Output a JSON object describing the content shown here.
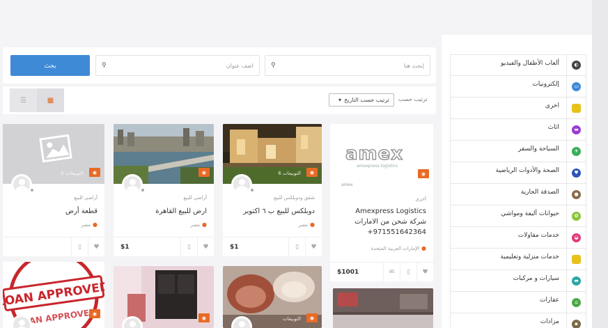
{
  "search": {
    "button_label": "بحث",
    "location_placeholder": "اضف عنوان",
    "query_placeholder": "إبحث هنا"
  },
  "sort": {
    "label": "ترتيب حسب",
    "selected": "ترتيب حسب التاريخ"
  },
  "listings": [
    {
      "category": "آخرى",
      "title_line1": "Amexpress Logistics",
      "title_line2": "شركة شحن من الامارات",
      "title_line3": "+971551642364",
      "location": "الإمارات العربية المتحدة",
      "price": "$1001",
      "badge": "",
      "logo_text": "amex",
      "logo_sub": "amexpress logistics",
      "logo_tiny": "amex"
    },
    {
      "category": "شقق ودوبلكس للبيع",
      "title": "دوبلكس للبيع ب ٦ اكتوبر",
      "location": "مصر",
      "price": "$1",
      "badge": "",
      "photos": "6 التوبيعات"
    },
    {
      "category": "أراضي للبيع",
      "title": "ارض للبيع القاهرة",
      "location": "مصر",
      "price": "$1",
      "badge": ""
    },
    {
      "category": "أراضي للبيع",
      "title": "قطعة أرض",
      "location": "مصر",
      "price": "",
      "badge": "",
      "photos": "0 التوبيعات"
    }
  ],
  "second_row": {
    "stamp_text_1": "LOAN APPROVED",
    "stamp_text_2": "LOAN APPROVED",
    "furniture_photos": "التوبيعات"
  },
  "sidebar": {
    "items": [
      {
        "label": "ألعاب الأطفال والفيديو",
        "icon": "game-icon",
        "color": "#444444"
      },
      {
        "label": "إلكترونيات",
        "icon": "monitor-icon",
        "color": "#3f8ad6"
      },
      {
        "label": "اخرى",
        "icon": "folder-icon",
        "color": "#e8c21a"
      },
      {
        "label": "اثاث",
        "icon": "sofa-icon",
        "color": "#9b3ad6"
      },
      {
        "label": "السياحة والسفر",
        "icon": "plane-icon",
        "color": "#3aae5a"
      },
      {
        "label": "الصحة والأدوات الرياضية",
        "icon": "heart-icon",
        "color": "#2d55b8"
      },
      {
        "label": "الصدقة الجارية",
        "icon": "hands-icon",
        "color": "#8a6a4a"
      },
      {
        "label": "حيوانات أليفة ومواشي",
        "icon": "paw-icon",
        "color": "#8ac43a"
      },
      {
        "label": "خدمات مقاولات",
        "icon": "helmet-icon",
        "color": "#e23a7a"
      },
      {
        "label": "خدمات منزلية وتعليمية",
        "icon": "book-icon",
        "color": "#e8c21a"
      },
      {
        "label": "سيارات و مركبات",
        "icon": "car-icon",
        "color": "#2aa6a6"
      },
      {
        "label": "عقارات",
        "icon": "home-icon",
        "color": "#4aa84a"
      },
      {
        "label": "مزادات",
        "icon": "gavel-icon",
        "color": "#7a6a4a"
      }
    ]
  }
}
